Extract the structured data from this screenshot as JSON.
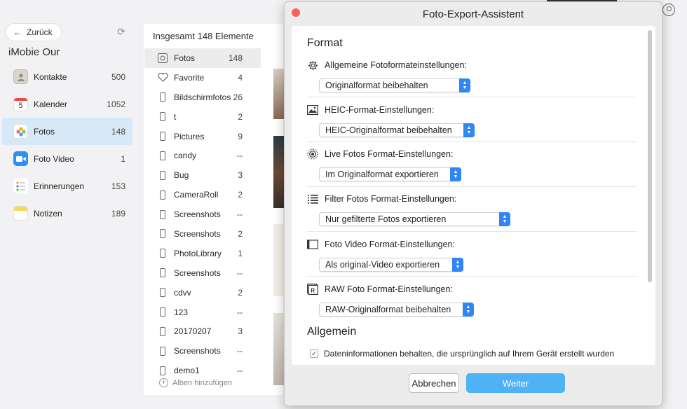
{
  "sidebar": {
    "back_label": "Zurück",
    "device_name": "iMobie Our",
    "items": [
      {
        "label": "Kontakte",
        "count": "500",
        "icon": "contacts-icon",
        "color": "#d9d4cc"
      },
      {
        "label": "Kalender",
        "count": "1052",
        "icon": "calendar-icon",
        "color": "#ffffff"
      },
      {
        "label": "Fotos",
        "count": "148",
        "icon": "photos-icon",
        "color": "#f5f5f5"
      },
      {
        "label": "Foto Video",
        "count": "1",
        "icon": "video-icon",
        "color": "#2e8ff5"
      },
      {
        "label": "Erinnerungen",
        "count": "153",
        "icon": "reminders-icon",
        "color": "#ffffff"
      },
      {
        "label": "Notizen",
        "count": "189",
        "icon": "notes-icon",
        "color": "#f6d85a"
      }
    ],
    "calendar_day": "5"
  },
  "albums": {
    "header": "Insgesamt 148 Elemente",
    "items": [
      {
        "label": "Fotos",
        "count": "148"
      },
      {
        "label": "Favorite",
        "count": "4"
      },
      {
        "label": "Bildschirmfotos",
        "count": "26"
      },
      {
        "label": "t",
        "count": "2"
      },
      {
        "label": "Pictures",
        "count": "9"
      },
      {
        "label": "candy",
        "count": "--"
      },
      {
        "label": "Bug",
        "count": "3"
      },
      {
        "label": "CameraRoll",
        "count": "2"
      },
      {
        "label": "Screenshots",
        "count": "--"
      },
      {
        "label": "Screenshots",
        "count": "2"
      },
      {
        "label": "PhotoLibrary",
        "count": "1"
      },
      {
        "label": "Screenshots",
        "count": "--"
      },
      {
        "label": "cdvv",
        "count": "2"
      },
      {
        "label": "123",
        "count": "--"
      },
      {
        "label": "20170207",
        "count": "3"
      },
      {
        "label": "Screenshots",
        "count": "--"
      },
      {
        "label": "demo1",
        "count": "--"
      }
    ],
    "add_label": "Alben hinzufügen"
  },
  "dialog": {
    "title": "Foto-Export-Assistent",
    "section_format": "Format",
    "settings": [
      {
        "label": "Allgemeine Fotoformateinstellungen:",
        "value": "Originalformat beibehalten",
        "icon": "gear-icon"
      },
      {
        "label": "HEIC-Format-Einstellungen:",
        "value": "HEIC-Originalformat beibehalten",
        "icon": "image-icon"
      },
      {
        "label": "Live Fotos Format-Einstellungen:",
        "value": "Im Originalformat exportieren",
        "icon": "live-photo-icon"
      },
      {
        "label": "Filter Fotos Format-Einstellungen:",
        "value": "Nur gefilterte Fotos exportieren",
        "icon": "list-icon"
      },
      {
        "label": "Foto Video Format-Einstellungen:",
        "value": "Als original-Video exportieren",
        "icon": "video-frame-icon"
      },
      {
        "label": "RAW Foto Format-Einstellungen:",
        "value": "RAW-Originalformat beibehalten",
        "icon": "raw-icon"
      }
    ],
    "section_general": "Allgemein",
    "checkbox_label": "Dateninformationen behalten, die ursprünglich auf Ihrem Gerät erstellt wurden",
    "checkbox_checked": true,
    "cancel_label": "Abbrechen",
    "next_label": "Weiter"
  },
  "colors": {
    "accent": "#2f86f5",
    "primary_button": "#4fb2f7",
    "sidebar_active": "#d7e8f6"
  }
}
